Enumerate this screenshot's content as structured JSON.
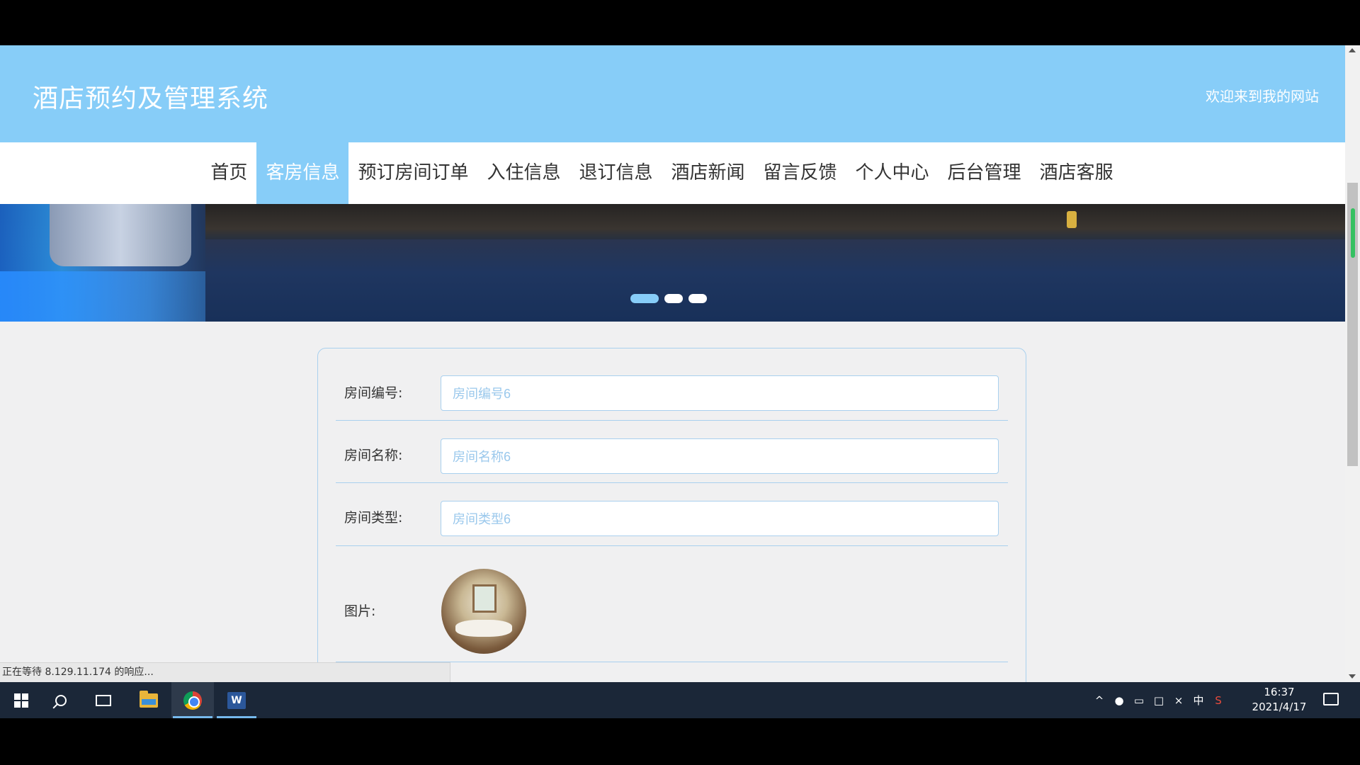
{
  "site": {
    "title": "酒店预约及管理系统",
    "welcome": "欢迎来到我的网站"
  },
  "nav": {
    "items": [
      {
        "label": "首页",
        "active": false
      },
      {
        "label": "客房信息",
        "active": true
      },
      {
        "label": "预订房间订单",
        "active": false
      },
      {
        "label": "入住信息",
        "active": false
      },
      {
        "label": "退订信息",
        "active": false
      },
      {
        "label": "酒店新闻",
        "active": false
      },
      {
        "label": "留言反馈",
        "active": false
      },
      {
        "label": "个人中心",
        "active": false
      },
      {
        "label": "后台管理",
        "active": false
      },
      {
        "label": "酒店客服",
        "active": false
      }
    ]
  },
  "carousel": {
    "slide_count": 3,
    "active_index": 0
  },
  "form": {
    "room_number": {
      "label": "房间编号:",
      "value": "房间编号6"
    },
    "room_name": {
      "label": "房间名称:",
      "value": "房间名称6"
    },
    "room_type": {
      "label": "房间类型:",
      "value": "房间类型6"
    },
    "image": {
      "label": "图片:"
    }
  },
  "status_bar": {
    "text": "正在等待 8.129.11.174 的响应..."
  },
  "taskbar": {
    "icons": [
      "windows-start-icon",
      "search-icon",
      "task-view-icon",
      "file-explorer-icon",
      "chrome-icon",
      "word-icon"
    ],
    "ime": "中",
    "time": "16:37",
    "date": "2021/4/17"
  },
  "colors": {
    "accent": "#87cdf8",
    "border": "#a9d0ee",
    "input_text": "#9ac8ec",
    "taskbar": "#1b2738"
  }
}
